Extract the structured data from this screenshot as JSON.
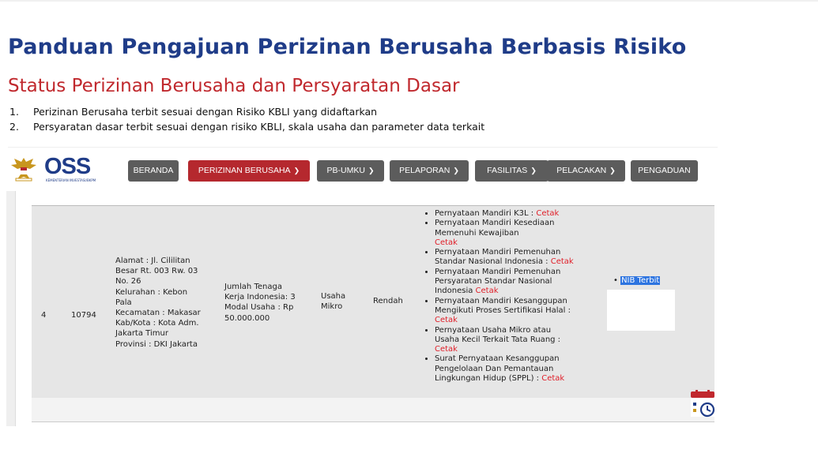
{
  "doc": {
    "title": "Panduan Pengajuan Perizinan Berusaha Berbasis Risiko",
    "subtitle": "Status Perizinan Berusaha dan Persyaratan Dasar",
    "points": [
      {
        "num": "1.",
        "text": "Perizinan Berusaha terbit sesuai dengan Risiko KBLI yang didaftarkan"
      },
      {
        "num": "2.",
        "text": "Persyaratan dasar terbit sesuai dengan risiko KBLI, skala usaha dan parameter data terkait"
      }
    ]
  },
  "nav": {
    "logo": "OSS",
    "logo_sub": "KEMENTERIAN INVESTASI/BKPM",
    "items": [
      {
        "label": "BERANDA",
        "dropdown": false
      },
      {
        "label": "PERIZINAN BERUSAHA",
        "dropdown": true,
        "active": true
      },
      {
        "label": "PB-UMKU",
        "dropdown": true
      },
      {
        "label": "PELAPORAN",
        "dropdown": true
      },
      {
        "label": "FASILITAS",
        "dropdown": true
      },
      {
        "label": "PELACAKAN",
        "dropdown": true
      },
      {
        "label": "PENGADUAN",
        "dropdown": false
      }
    ],
    "active_color": "#b5282e"
  },
  "row": {
    "no": "4",
    "id": "10794",
    "address": [
      "Alamat : Jl. Cililitan",
      "Besar Rt. 003 Rw. 03",
      "No. 26",
      "Kelurahan : Kebon",
      "Pala",
      "Kecamatan : Makasar",
      "Kab/Kota : Kota Adm.",
      "Jakarta Timur",
      "Provinsi : DKI Jakarta"
    ],
    "workforce": [
      "Jumlah Tenaga",
      "Kerja Indonesia: 3",
      "Modal Usaha : Rp",
      "50.000.000"
    ],
    "type": [
      "Usaha",
      "Mikro"
    ],
    "risk": "Rendah",
    "requirements": [
      {
        "lines": [
          "Pernyataan Mandiri K3L : "
        ],
        "link": "Cetak",
        "link_inline": true
      },
      {
        "lines": [
          "Pernyataan Mandiri Kesediaan",
          "Memenuhi Kewajiban"
        ],
        "link": "Cetak",
        "link_inline": false
      },
      {
        "lines": [
          "Pernyataan Mandiri Pemenuhan",
          "Standar Nasional Indonesia : "
        ],
        "link": "Cetak",
        "link_inline": true
      },
      {
        "lines": [
          "Pernyataan Mandiri Pemenuhan",
          "Persyaratan Standar Nasional",
          "Indonesia "
        ],
        "link": "Cetak",
        "link_inline": true
      },
      {
        "lines": [
          "Pernyataan Mandiri Kesanggupan",
          "Mengikuti Proses Sertifikasi Halal :"
        ],
        "link": "Cetak",
        "link_inline": false
      },
      {
        "lines": [
          "Pernyataan Usaha Mikro atau",
          "Usaha Kecil Terkait Tata Ruang :"
        ],
        "link": "Cetak",
        "link_inline": false
      },
      {
        "lines": [
          "Surat Pernyataan Kesanggupan",
          "Pengelolaan Dan Pemantauan",
          "Lingkungan Hidup (SPPL) : "
        ],
        "link": "Cetak",
        "link_inline": true
      }
    ],
    "nib": "NIB Terbit"
  },
  "icons": {
    "calendar": "calendar-clock-icon",
    "garuda": "garuda-emblem-icon"
  }
}
